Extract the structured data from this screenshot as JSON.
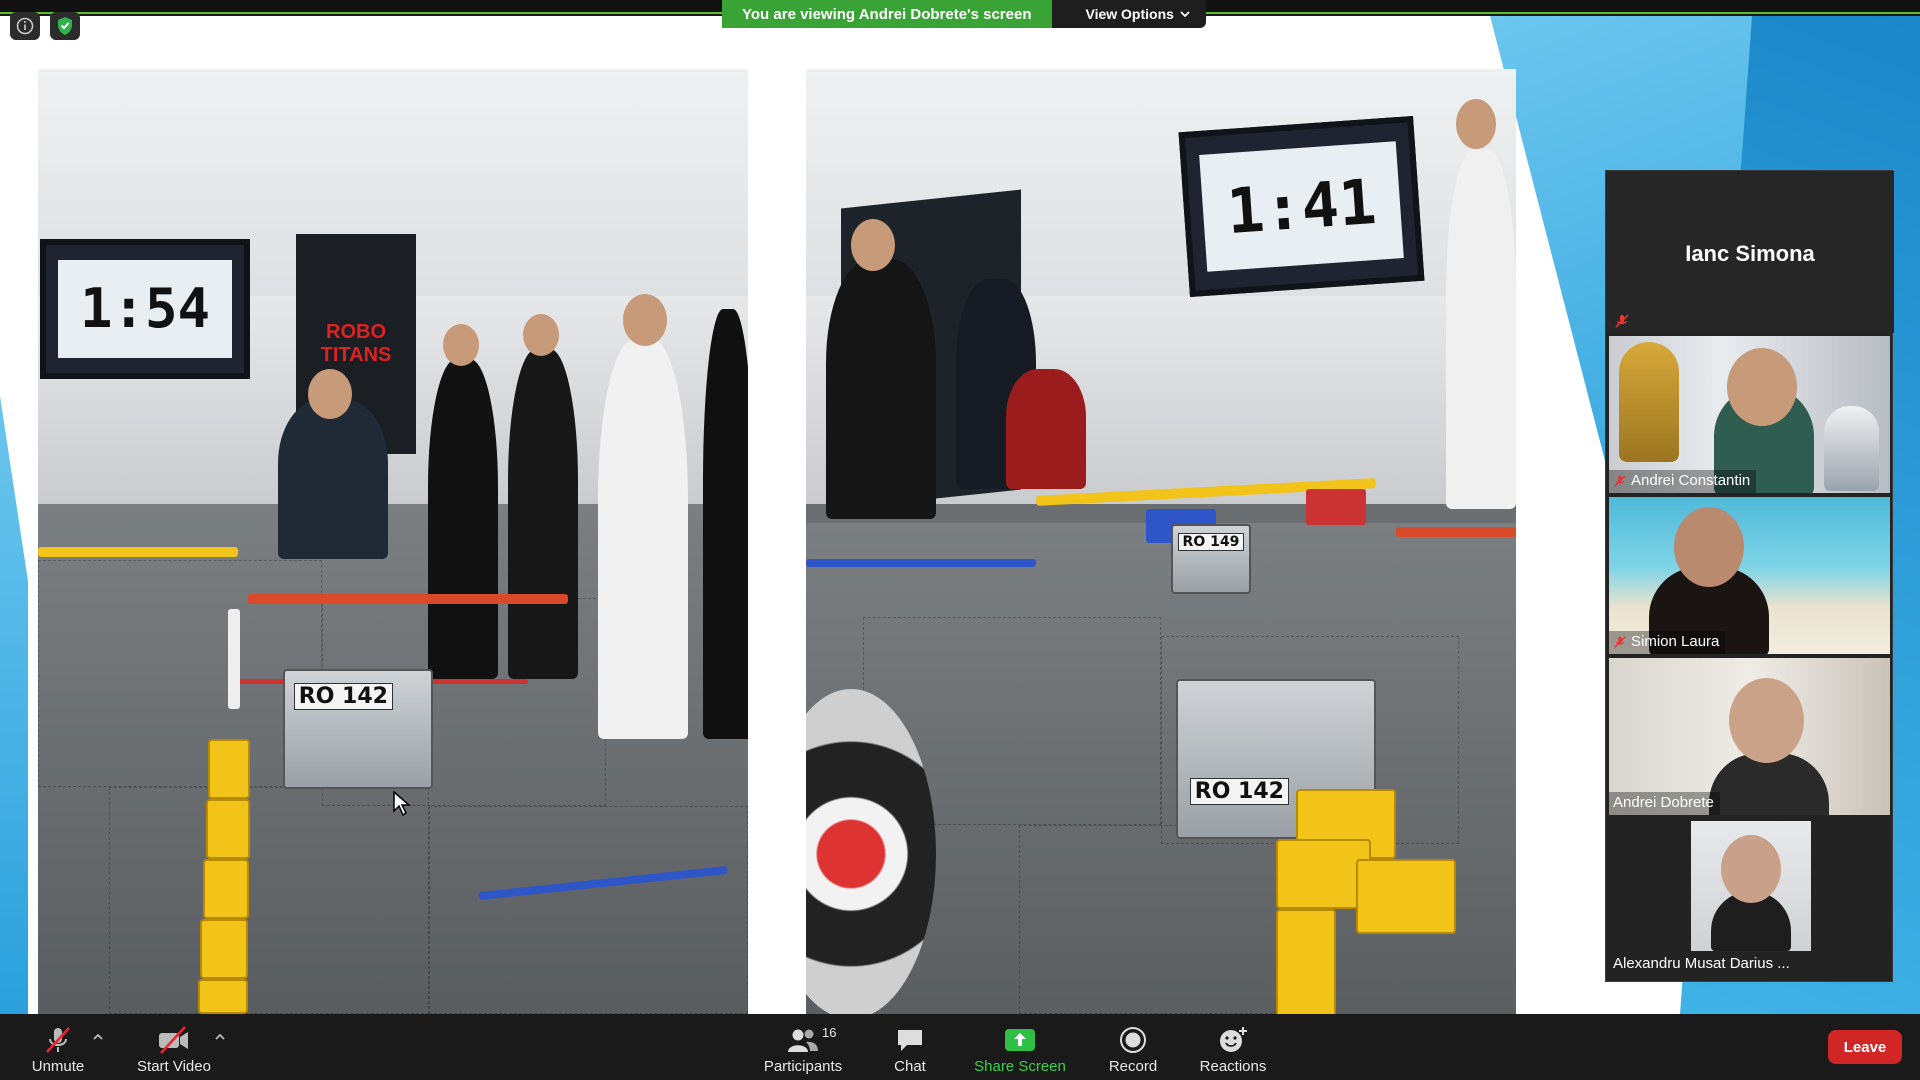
{
  "top": {
    "share_message": "You are viewing Andrei Dobrete's screen",
    "view_options": "View Options"
  },
  "slide": {
    "left_photo": {
      "scoreboard": "1:54",
      "banner": "ROBO TITANS",
      "robot_tag": "RO 142"
    },
    "right_photo": {
      "scoreboard": "1:41",
      "robot_tag_back": "RO 149",
      "robot_tag_front": "RO 142"
    }
  },
  "gallery": {
    "active_speaker": "Ianc Simona",
    "participants": [
      {
        "name": "Andrei Constantin",
        "muted": true
      },
      {
        "name": "Simion Laura",
        "muted": true
      },
      {
        "name": "Andrei Dobrete",
        "muted": false
      },
      {
        "name": "Alexandru Musat Darius ...",
        "muted": false
      }
    ]
  },
  "toolbar": {
    "unmute": "Unmute",
    "start_video": "Start Video",
    "participants": "Participants",
    "participant_count": "16",
    "chat": "Chat",
    "share_screen": "Share Screen",
    "record": "Record",
    "reactions": "Reactions",
    "leave": "Leave"
  },
  "colors": {
    "share_green": "#3aa335",
    "leave_red": "#d12626",
    "toolbar_bg": "#1a1a1a",
    "slide_accent_blue": "#2aa0dc"
  }
}
